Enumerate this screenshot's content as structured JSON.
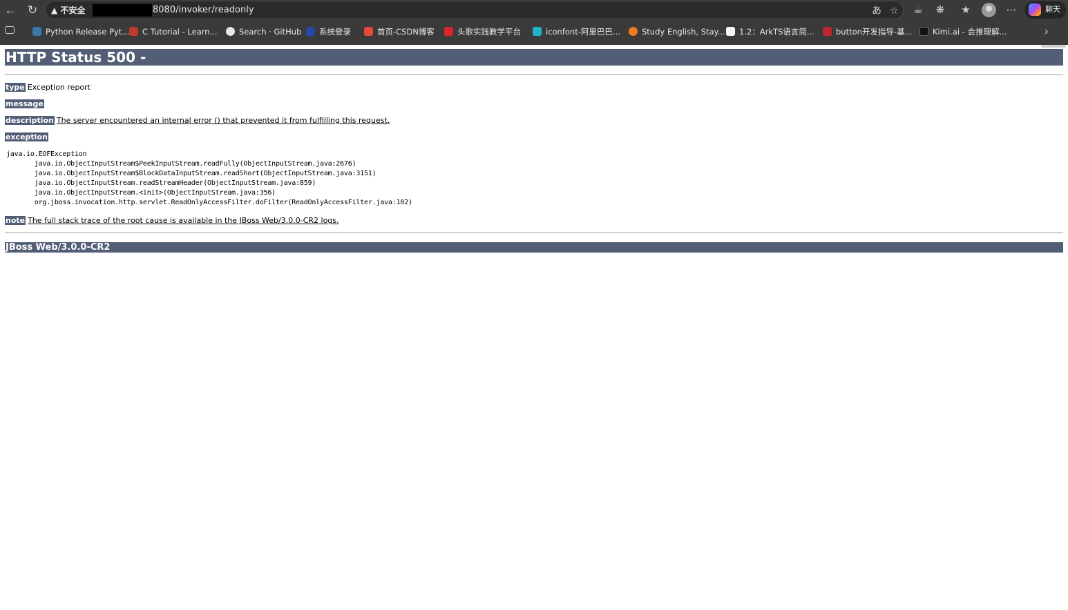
{
  "browser": {
    "security_label": "不安全",
    "url": "8080/invoker/readonly",
    "copilot_label": "聊天",
    "bookmarks": [
      {
        "label": "Python Release Pyt...",
        "color": "#3b77a8"
      },
      {
        "label": "C Tutorial - Learn...",
        "color": "#c0392b"
      },
      {
        "label": "Search · GitHub",
        "color": "#e6e6e6"
      },
      {
        "label": "系统登录",
        "color": "#2747a8"
      },
      {
        "label": "首页-CSDN博客",
        "color": "#e4493a"
      },
      {
        "label": "头歌实践教学平台",
        "color": "#d8262b"
      },
      {
        "label": "iconfont-阿里巴巴...",
        "color": "#23b0c8"
      },
      {
        "label": "Study English, Stay...",
        "color": "#f07a1c"
      },
      {
        "label": "1.2：ArkTS语言简...",
        "color": "#f5f5f5"
      },
      {
        "label": "button开发指导-基...",
        "color": "#c0262b"
      },
      {
        "label": "Kimi.ai - 会推理解...",
        "color": "#111111"
      }
    ]
  },
  "page": {
    "title": "HTTP Status 500 -",
    "type_label": "type",
    "type_value": "Exception report",
    "message_label": "message",
    "message_value": "",
    "description_label": "description",
    "description_value": "The server encountered an internal error () that prevented it from fulfilling this request.",
    "exception_label": "exception",
    "stack_trace": "java.io.EOFException\n\tjava.io.ObjectInputStream$PeekInputStream.readFully(ObjectInputStream.java:2676)\n\tjava.io.ObjectInputStream$BlockDataInputStream.readShort(ObjectInputStream.java:3151)\n\tjava.io.ObjectInputStream.readStreamHeader(ObjectInputStream.java:859)\n\tjava.io.ObjectInputStream.<init>(ObjectInputStream.java:356)\n\torg.jboss.invocation.http.servlet.ReadOnlyAccessFilter.doFilter(ReadOnlyAccessFilter.java:102)",
    "note_label": "note",
    "note_value": "The full stack trace of the root cause is available in the JBoss Web/3.0.0-CR2 logs.",
    "footer": "JBoss Web/3.0.0-CR2"
  },
  "colors": {
    "header_bg": "#525D76",
    "chrome_bg": "#3a3a3a"
  }
}
